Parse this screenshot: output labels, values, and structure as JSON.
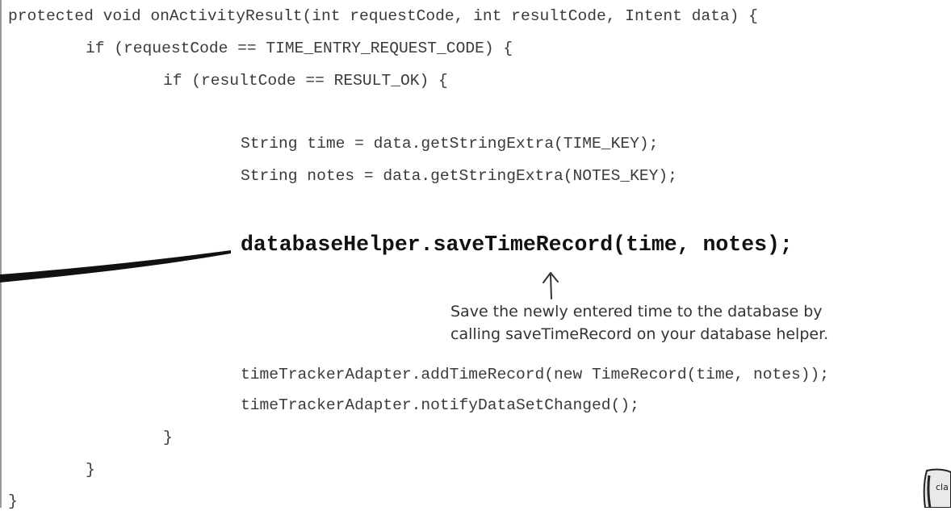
{
  "code": {
    "line1": "protected void onActivityResult(int requestCode, int resultCode, Intent data) {",
    "line2": "if (requestCode == TIME_ENTRY_REQUEST_CODE) {",
    "line3": "if (resultCode == RESULT_OK) {",
    "line4": "String time = data.getStringExtra(TIME_KEY);",
    "line5": "String notes = data.getStringExtra(NOTES_KEY);",
    "highlight": "databaseHelper.saveTimeRecord(time, notes);",
    "line7": "timeTrackerAdapter.addTimeRecord(new TimeRecord(time, notes));",
    "line8": "timeTrackerAdapter.notifyDataSetChanged();",
    "close3": "}",
    "close2": "}",
    "close1": "}"
  },
  "annotation": {
    "line1": "Save the newly entered time to the database by",
    "line2": "calling saveTimeRecord on your database helper."
  },
  "doodle": {
    "text": "cla"
  }
}
